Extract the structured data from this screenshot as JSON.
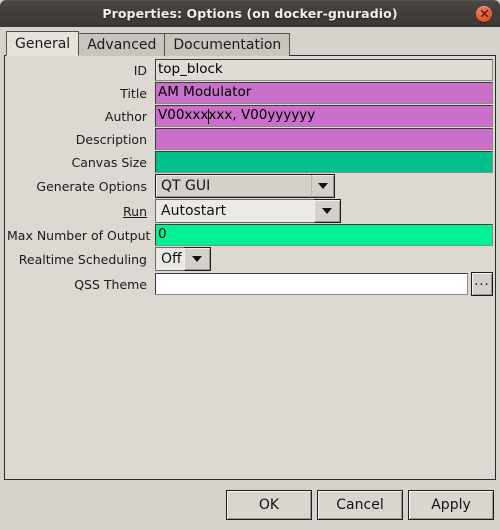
{
  "window": {
    "title": "Properties: Options (on docker-gnuradio)",
    "close_icon": "close-icon",
    "close_glyph": "×"
  },
  "tabs": [
    {
      "label": "General",
      "active": true
    },
    {
      "label": "Advanced",
      "active": false
    },
    {
      "label": "Documentation",
      "active": false
    }
  ],
  "form": {
    "rows": [
      {
        "label": "ID",
        "type": "text",
        "value": "top_block",
        "style": "bg-readonly",
        "name": "id"
      },
      {
        "label": "Title",
        "type": "text",
        "value": "AM Modulator",
        "style": "bg-magenta",
        "name": "title"
      },
      {
        "label": "Author",
        "type": "text",
        "value_before_caret": "V00xxx",
        "value_after_caret": "xxx, V00yyyyyy",
        "value": "V00xxxxxx, V00yyyyyy",
        "style": "bg-magenta",
        "name": "author"
      },
      {
        "label": "Description",
        "type": "text",
        "value": "",
        "style": "bg-magenta",
        "name": "description"
      },
      {
        "label": "Canvas Size",
        "type": "text",
        "value": "",
        "style": "bg-teal",
        "name": "canvas-size"
      },
      {
        "label": "Generate Options",
        "type": "combo",
        "value": "QT GUI",
        "name": "generate-options"
      },
      {
        "label": "Run",
        "type": "combo",
        "value": "Autostart",
        "underline": true,
        "name": "run"
      },
      {
        "label": "Max Number of Output",
        "type": "text",
        "value": "0",
        "style": "bg-spring",
        "name": "max-number-of-output"
      },
      {
        "label": "Realtime Scheduling",
        "type": "combo",
        "value": "Off",
        "name": "realtime-scheduling"
      },
      {
        "label": "QSS Theme",
        "type": "text-browse",
        "value": "",
        "style": "bg-white",
        "browse_label": "...",
        "name": "qss-theme"
      }
    ]
  },
  "buttons": {
    "ok": "OK",
    "cancel": "Cancel",
    "apply": "Apply"
  },
  "colors": {
    "titlebar": "#413d39",
    "close_button": "#e05c36",
    "panel": "#dcd9d3",
    "magenta_field": "#ca6fca",
    "teal_field": "#00bf8a",
    "spring_field": "#00f294",
    "readonly_field": "#e0ddd7"
  }
}
